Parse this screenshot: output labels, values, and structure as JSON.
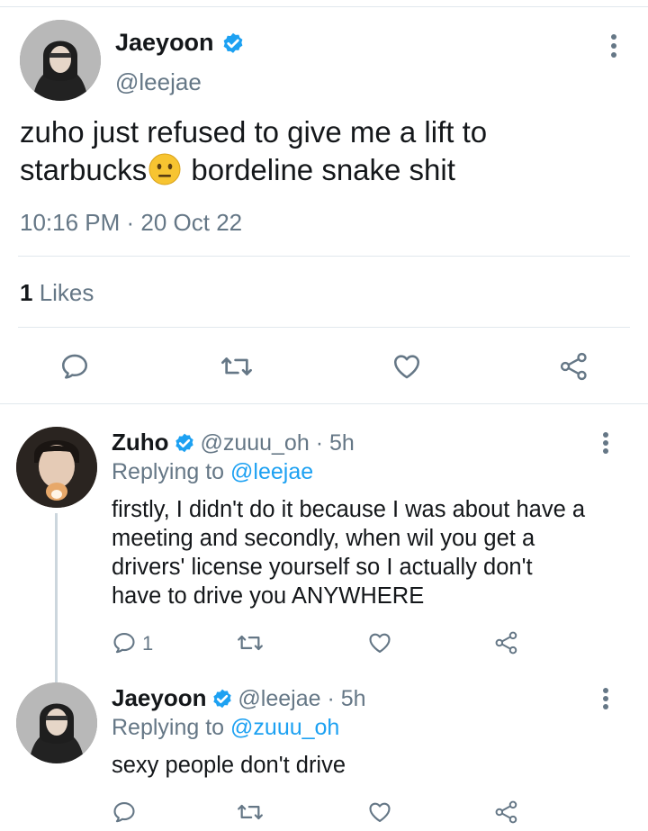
{
  "main_tweet": {
    "name": "Jaeyoon",
    "handle": "@leejae",
    "text_line1": "zuho just refused to give me a lift to",
    "text_line2_a": "starbucks",
    "emoji": "😐",
    "text_line2_b": " bordeline snake shit",
    "timestamp": "10:16 PM · 20 Oct 22",
    "likes_count": "1",
    "likes_label": " Likes"
  },
  "replies": [
    {
      "name": "Zuho",
      "handle": "@zuuu_oh",
      "time": " · 5h",
      "replying_prefix": "Replying to ",
      "replying_to": "@leejae",
      "lines": [
        "firstly, I didn't do it because I was about have a",
        "meeting and secondly, when wil you get a",
        "drivers' license yourself so I actually don't",
        "have to drive you ANYWHERE"
      ],
      "reply_count": "1"
    },
    {
      "name": "Jaeyoon",
      "handle": "@leejae",
      "time": " · 5h",
      "replying_prefix": "Replying to ",
      "replying_to": "@zuuu_oh",
      "lines": [
        "sexy people don't drive"
      ],
      "reply_count": ""
    }
  ],
  "colors": {
    "verified": "#1da1f2",
    "muted": "#657786",
    "link": "#1da1f2",
    "divider": "#e1e8ed"
  },
  "icons": [
    "more-vertical-icon",
    "verified-badge-icon",
    "reply-icon",
    "retweet-icon",
    "like-icon",
    "share-icon"
  ]
}
